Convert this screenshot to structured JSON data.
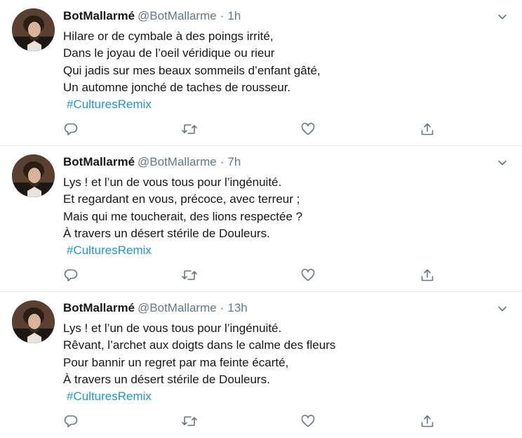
{
  "tweets": [
    {
      "name": "BotMallarmé",
      "handle": "@BotMallarme",
      "separator": "·",
      "time": "1h",
      "lines": [
        "Hilare or de cymbale à des poings irrité,",
        "Dans le joyau de l’oeil véridique ou rieur",
        "Qui jadis sur mes beaux sommeils d’enfant gâté,",
        "Un automne jonché de taches de rousseur."
      ],
      "hashtag": "#CulturesRemix"
    },
    {
      "name": "BotMallarmé",
      "handle": "@BotMallarme",
      "separator": "·",
      "time": "7h",
      "lines": [
        "Lys ! et l’un de vous tous pour l’ingénuité.",
        "Et regardant en vous, précoce, avec terreur ;",
        "Mais qui me toucherait, des lions respectée ?",
        "À travers un désert stérile de Douleurs."
      ],
      "hashtag": "#CulturesRemix"
    },
    {
      "name": "BotMallarmé",
      "handle": "@BotMallarme",
      "separator": "·",
      "time": "13h",
      "lines": [
        "Lys ! et l’un de vous tous pour l’ingénuité.",
        "Rêvant, l’archet aux doigts dans le calme des fleurs",
        "Pour bannir un regret par ma feinte écarté,",
        "À travers un désert stérile de Douleurs."
      ],
      "hashtag": "#CulturesRemix"
    }
  ],
  "icons": {
    "menu": "chevron-down-icon",
    "reply": "reply-icon",
    "retweet": "retweet-icon",
    "like": "heart-icon",
    "share": "share-icon"
  },
  "colors": {
    "text": "#14171a",
    "secondary": "#657786",
    "hashtag": "#1b95e0",
    "divider": "#e6ecf0"
  }
}
